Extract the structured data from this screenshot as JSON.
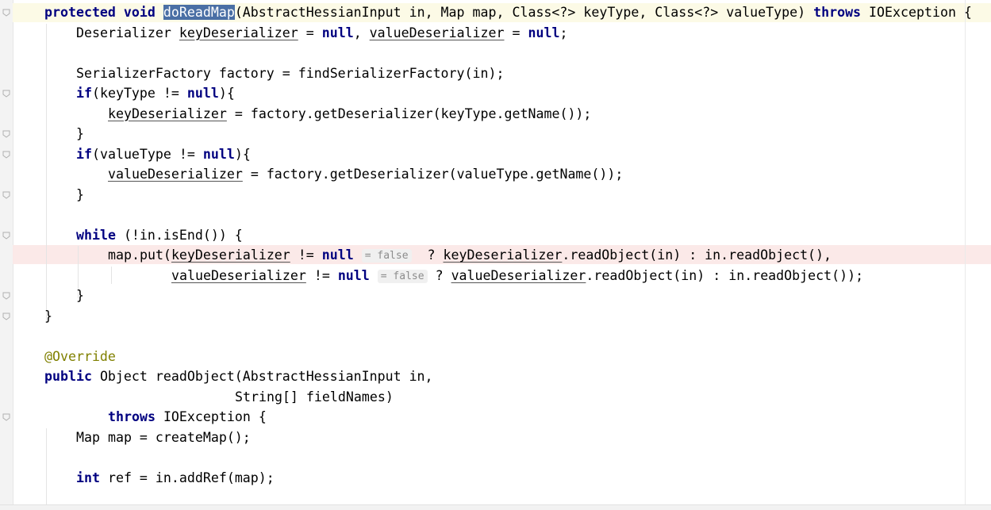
{
  "editor": {
    "language": "java",
    "lines": [
      {
        "indent": 1,
        "tokens": [
          {
            "t": "protected",
            "c": "kw"
          },
          {
            "t": " "
          },
          {
            "t": "void",
            "c": "kw"
          },
          {
            "t": " "
          },
          {
            "t": "doReadMap",
            "c": "sel"
          },
          {
            "t": "(AbstractHessianInput in, Map map, Class<?> keyType, Class<?> valueType) "
          },
          {
            "t": "throws",
            "c": "kw"
          },
          {
            "t": " IOException {"
          }
        ]
      },
      {
        "indent": 2,
        "tokens": [
          {
            "t": "Deserializer "
          },
          {
            "t": "keyDeserializer",
            "c": "field"
          },
          {
            "t": " = "
          },
          {
            "t": "null",
            "c": "kw"
          },
          {
            "t": ", "
          },
          {
            "t": "valueDeserializer",
            "c": "field"
          },
          {
            "t": " = "
          },
          {
            "t": "null",
            "c": "kw"
          },
          {
            "t": ";"
          }
        ]
      },
      {
        "indent": 0,
        "tokens": []
      },
      {
        "indent": 2,
        "tokens": [
          {
            "t": "SerializerFactory factory = findSerializerFactory(in);"
          }
        ]
      },
      {
        "indent": 2,
        "tokens": [
          {
            "t": "if",
            "c": "kw"
          },
          {
            "t": "(keyType != "
          },
          {
            "t": "null",
            "c": "kw"
          },
          {
            "t": "){"
          }
        ]
      },
      {
        "indent": 3,
        "tokens": [
          {
            "t": "keyDeserializer",
            "c": "field"
          },
          {
            "t": " = factory.getDeserializer(keyType.getName());"
          }
        ]
      },
      {
        "indent": 2,
        "tokens": [
          {
            "t": "}"
          }
        ]
      },
      {
        "indent": 2,
        "tokens": [
          {
            "t": "if",
            "c": "kw"
          },
          {
            "t": "(valueType != "
          },
          {
            "t": "null",
            "c": "kw"
          },
          {
            "t": "){"
          }
        ]
      },
      {
        "indent": 3,
        "tokens": [
          {
            "t": "valueDeserializer",
            "c": "field"
          },
          {
            "t": " = factory.getDeserializer(valueType.getName());"
          }
        ]
      },
      {
        "indent": 2,
        "tokens": [
          {
            "t": "}"
          }
        ]
      },
      {
        "indent": 0,
        "tokens": []
      },
      {
        "indent": 2,
        "tokens": [
          {
            "t": "while",
            "c": "kw"
          },
          {
            "t": " (!in.isEnd()) {"
          }
        ]
      },
      {
        "indent": 3,
        "tokens": [
          {
            "t": "map.put("
          },
          {
            "t": "keyDeserializer",
            "c": "field"
          },
          {
            "t": " != "
          },
          {
            "t": "null",
            "c": "kw"
          },
          {
            "t": " "
          },
          {
            "t": "= false",
            "c": "hint"
          },
          {
            "t": "  ? "
          },
          {
            "t": "keyDeserializer",
            "c": "field"
          },
          {
            "t": ".readObject(in) : in.readObject(),"
          }
        ]
      },
      {
        "indent": 5,
        "tokens": [
          {
            "t": "valueDeserializer",
            "c": "field"
          },
          {
            "t": " != "
          },
          {
            "t": "null",
            "c": "kw"
          },
          {
            "t": " "
          },
          {
            "t": "= false",
            "c": "hint"
          },
          {
            "t": " ? "
          },
          {
            "t": "valueDeserializer",
            "c": "field"
          },
          {
            "t": ".readObject(in) : in.readObject());"
          }
        ]
      },
      {
        "indent": 2,
        "tokens": [
          {
            "t": "}"
          }
        ]
      },
      {
        "indent": 1,
        "tokens": [
          {
            "t": "}"
          }
        ]
      },
      {
        "indent": 0,
        "tokens": []
      },
      {
        "indent": 1,
        "tokens": [
          {
            "t": "@Override",
            "c": "ann"
          }
        ]
      },
      {
        "indent": 1,
        "tokens": [
          {
            "t": "public",
            "c": "kw"
          },
          {
            "t": " Object readObject(AbstractHessianInput in,"
          }
        ]
      },
      {
        "indent": 7,
        "tokens": [
          {
            "t": "String[] fieldNames)"
          }
        ]
      },
      {
        "indent": 3,
        "tokens": [
          {
            "t": "throws",
            "c": "kw"
          },
          {
            "t": " IOException {"
          }
        ]
      },
      {
        "indent": 2,
        "tokens": [
          {
            "t": "Map map = createMap();"
          }
        ]
      },
      {
        "indent": 0,
        "tokens": []
      },
      {
        "indent": 2,
        "tokens": [
          {
            "t": "int",
            "c": "kw"
          },
          {
            "t": " ref = in.addRef(map);"
          }
        ]
      }
    ]
  }
}
